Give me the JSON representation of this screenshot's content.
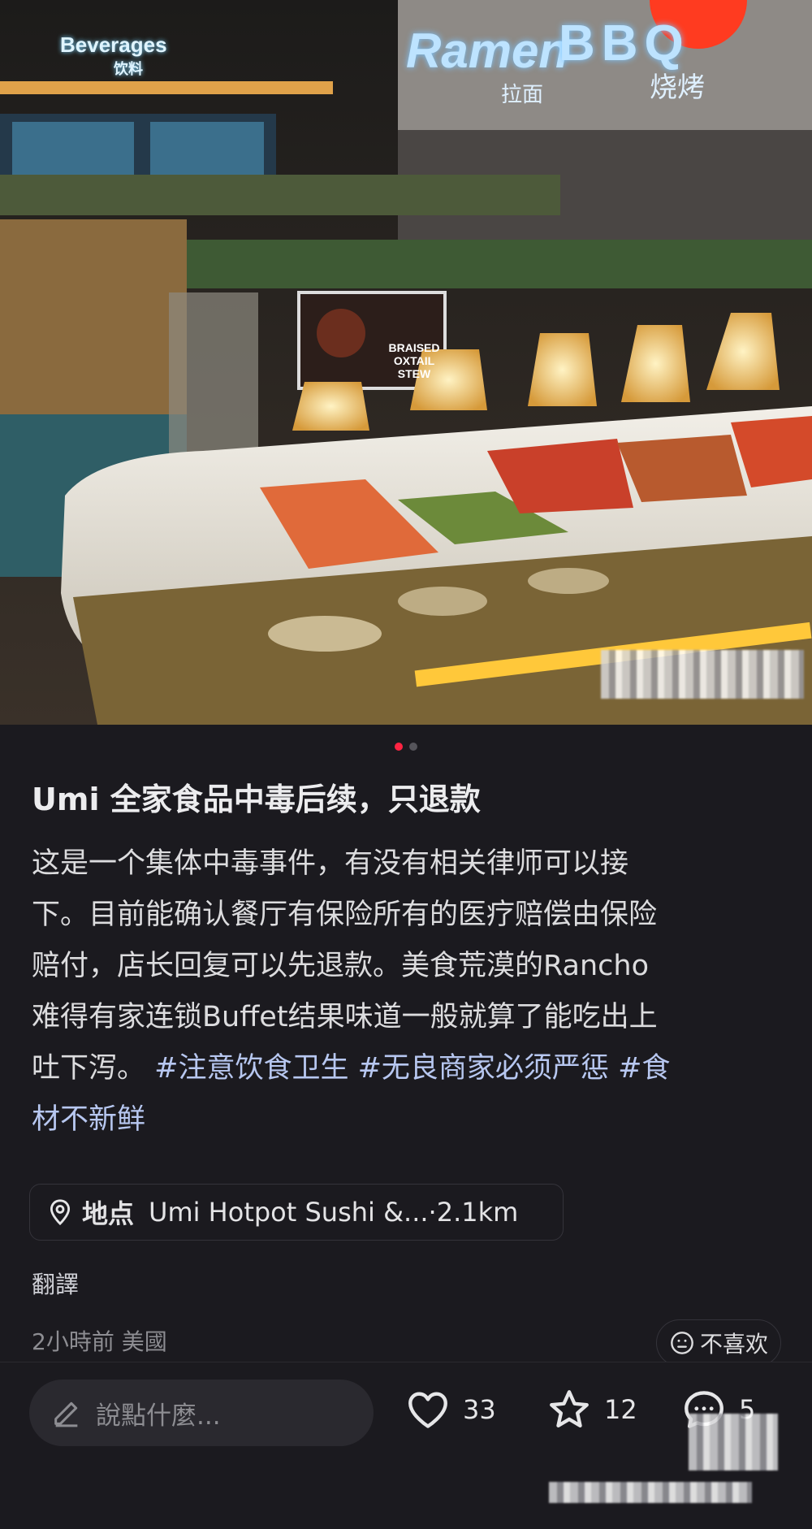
{
  "photo": {
    "signs": {
      "beverages": "Beverages",
      "beverages_cn": "饮料",
      "ramen": "Ramen",
      "bbq": "BBQ",
      "ramen_cn": "拉面",
      "bbq_cn": "烧烤",
      "stew_card": "BRAISED OXTAIL STEW"
    },
    "carousel": {
      "count": 2,
      "active_index": 0
    }
  },
  "post": {
    "title": "Umi 全家食品中毒后续，只退款",
    "body_lines": [
      "这是一个集体中毒事件，有没有相关律师可以接",
      "下。目前能确认餐厅有保险所有的医疗赔偿由保险",
      "赔付，店长回复可以先退款。美食荒漠的Rancho",
      "难得有家连锁Buffet结果味道一般就算了能吃出上"
    ],
    "line5_text": "吐下泻。 ",
    "tag1": "#注意饮食卫生",
    "tag2": "#无良商家必须严惩",
    "tag3a": "#食",
    "tag3b": "材不新鲜"
  },
  "location": {
    "label": "地点",
    "name": "Umi Hotpot Sushi &...",
    "distance": "·2.1km",
    "icon": "location-pin-icon"
  },
  "translate_label": "翻譯",
  "meta": {
    "time": "2小時前",
    "region": "美國"
  },
  "dislike_label": "不喜欢",
  "bottom_bar": {
    "comment_placeholder": "說點什麼...",
    "likes": "33",
    "stars": "12",
    "comments": "5"
  },
  "colors": {
    "accent": "#ff2442",
    "tag": "#b7c7f0",
    "background": "#1b1a1f"
  }
}
